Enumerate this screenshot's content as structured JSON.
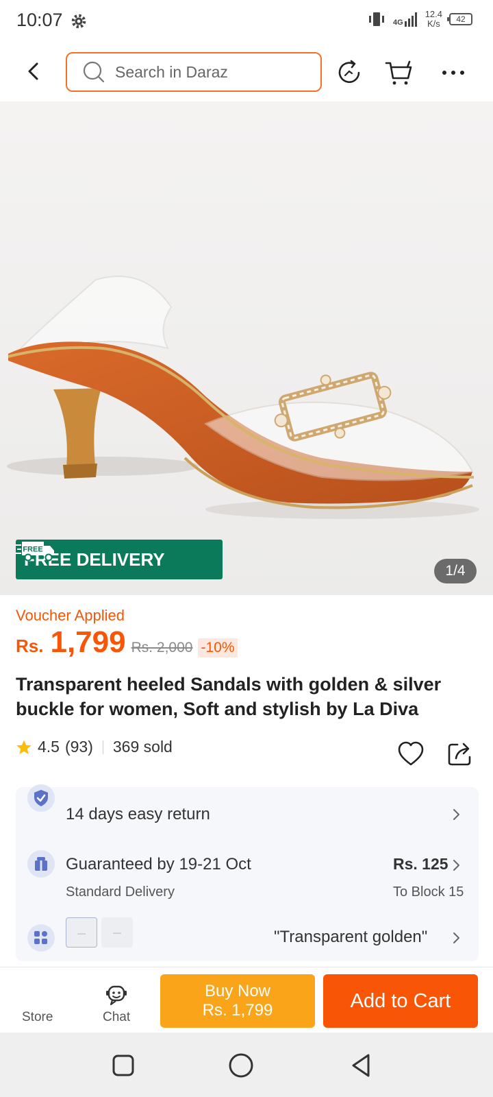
{
  "status_bar": {
    "time": "10:07",
    "network": "4G",
    "speed_value": "12.4",
    "speed_unit": "K/s",
    "battery": "42"
  },
  "header": {
    "search_placeholder": "Search in Daraz"
  },
  "product_image": {
    "badge": "FREE DELIVERY",
    "badge_truck_text": "FREE",
    "pager": "1/4"
  },
  "price": {
    "voucher": "Voucher Applied",
    "currency": "Rs.",
    "value": "1,799",
    "original": "Rs. 2,000",
    "discount": "-10%"
  },
  "product": {
    "title": "Transparent heeled Sandals with golden & silver buckle for women, Soft and stylish by La Diva",
    "rating": "4.5",
    "reviews": "(93)",
    "sold": "369 sold"
  },
  "info": {
    "return_text": "14 days easy return",
    "delivery_text": "Guaranteed by 19-21 Oct",
    "delivery_type": "Standard Delivery",
    "delivery_fee": "Rs. 125",
    "delivery_to": "To Block 15",
    "variant_selected": "\"Transparent golden\""
  },
  "bottom_bar": {
    "store_label": "Store",
    "chat_label": "Chat",
    "buy_now_label": "Buy Now",
    "buy_now_price": "Rs. 1,799",
    "add_to_cart_label": "Add to Cart"
  },
  "colors": {
    "accent": "#f85606",
    "buy_now": "#faa519",
    "free_delivery": "#0b7a5a"
  },
  "icons": [
    "settings-gear-icon",
    "back-arrow-icon",
    "search-icon",
    "refresh-icon",
    "cart-icon",
    "more-icon",
    "truck-icon",
    "star-icon",
    "heart-icon",
    "share-icon",
    "shield-check-icon",
    "gift-box-icon",
    "variant-grid-icon",
    "chevron-right-icon",
    "chat-icon",
    "nav-square-icon",
    "nav-circle-icon",
    "nav-back-triangle-icon"
  ]
}
